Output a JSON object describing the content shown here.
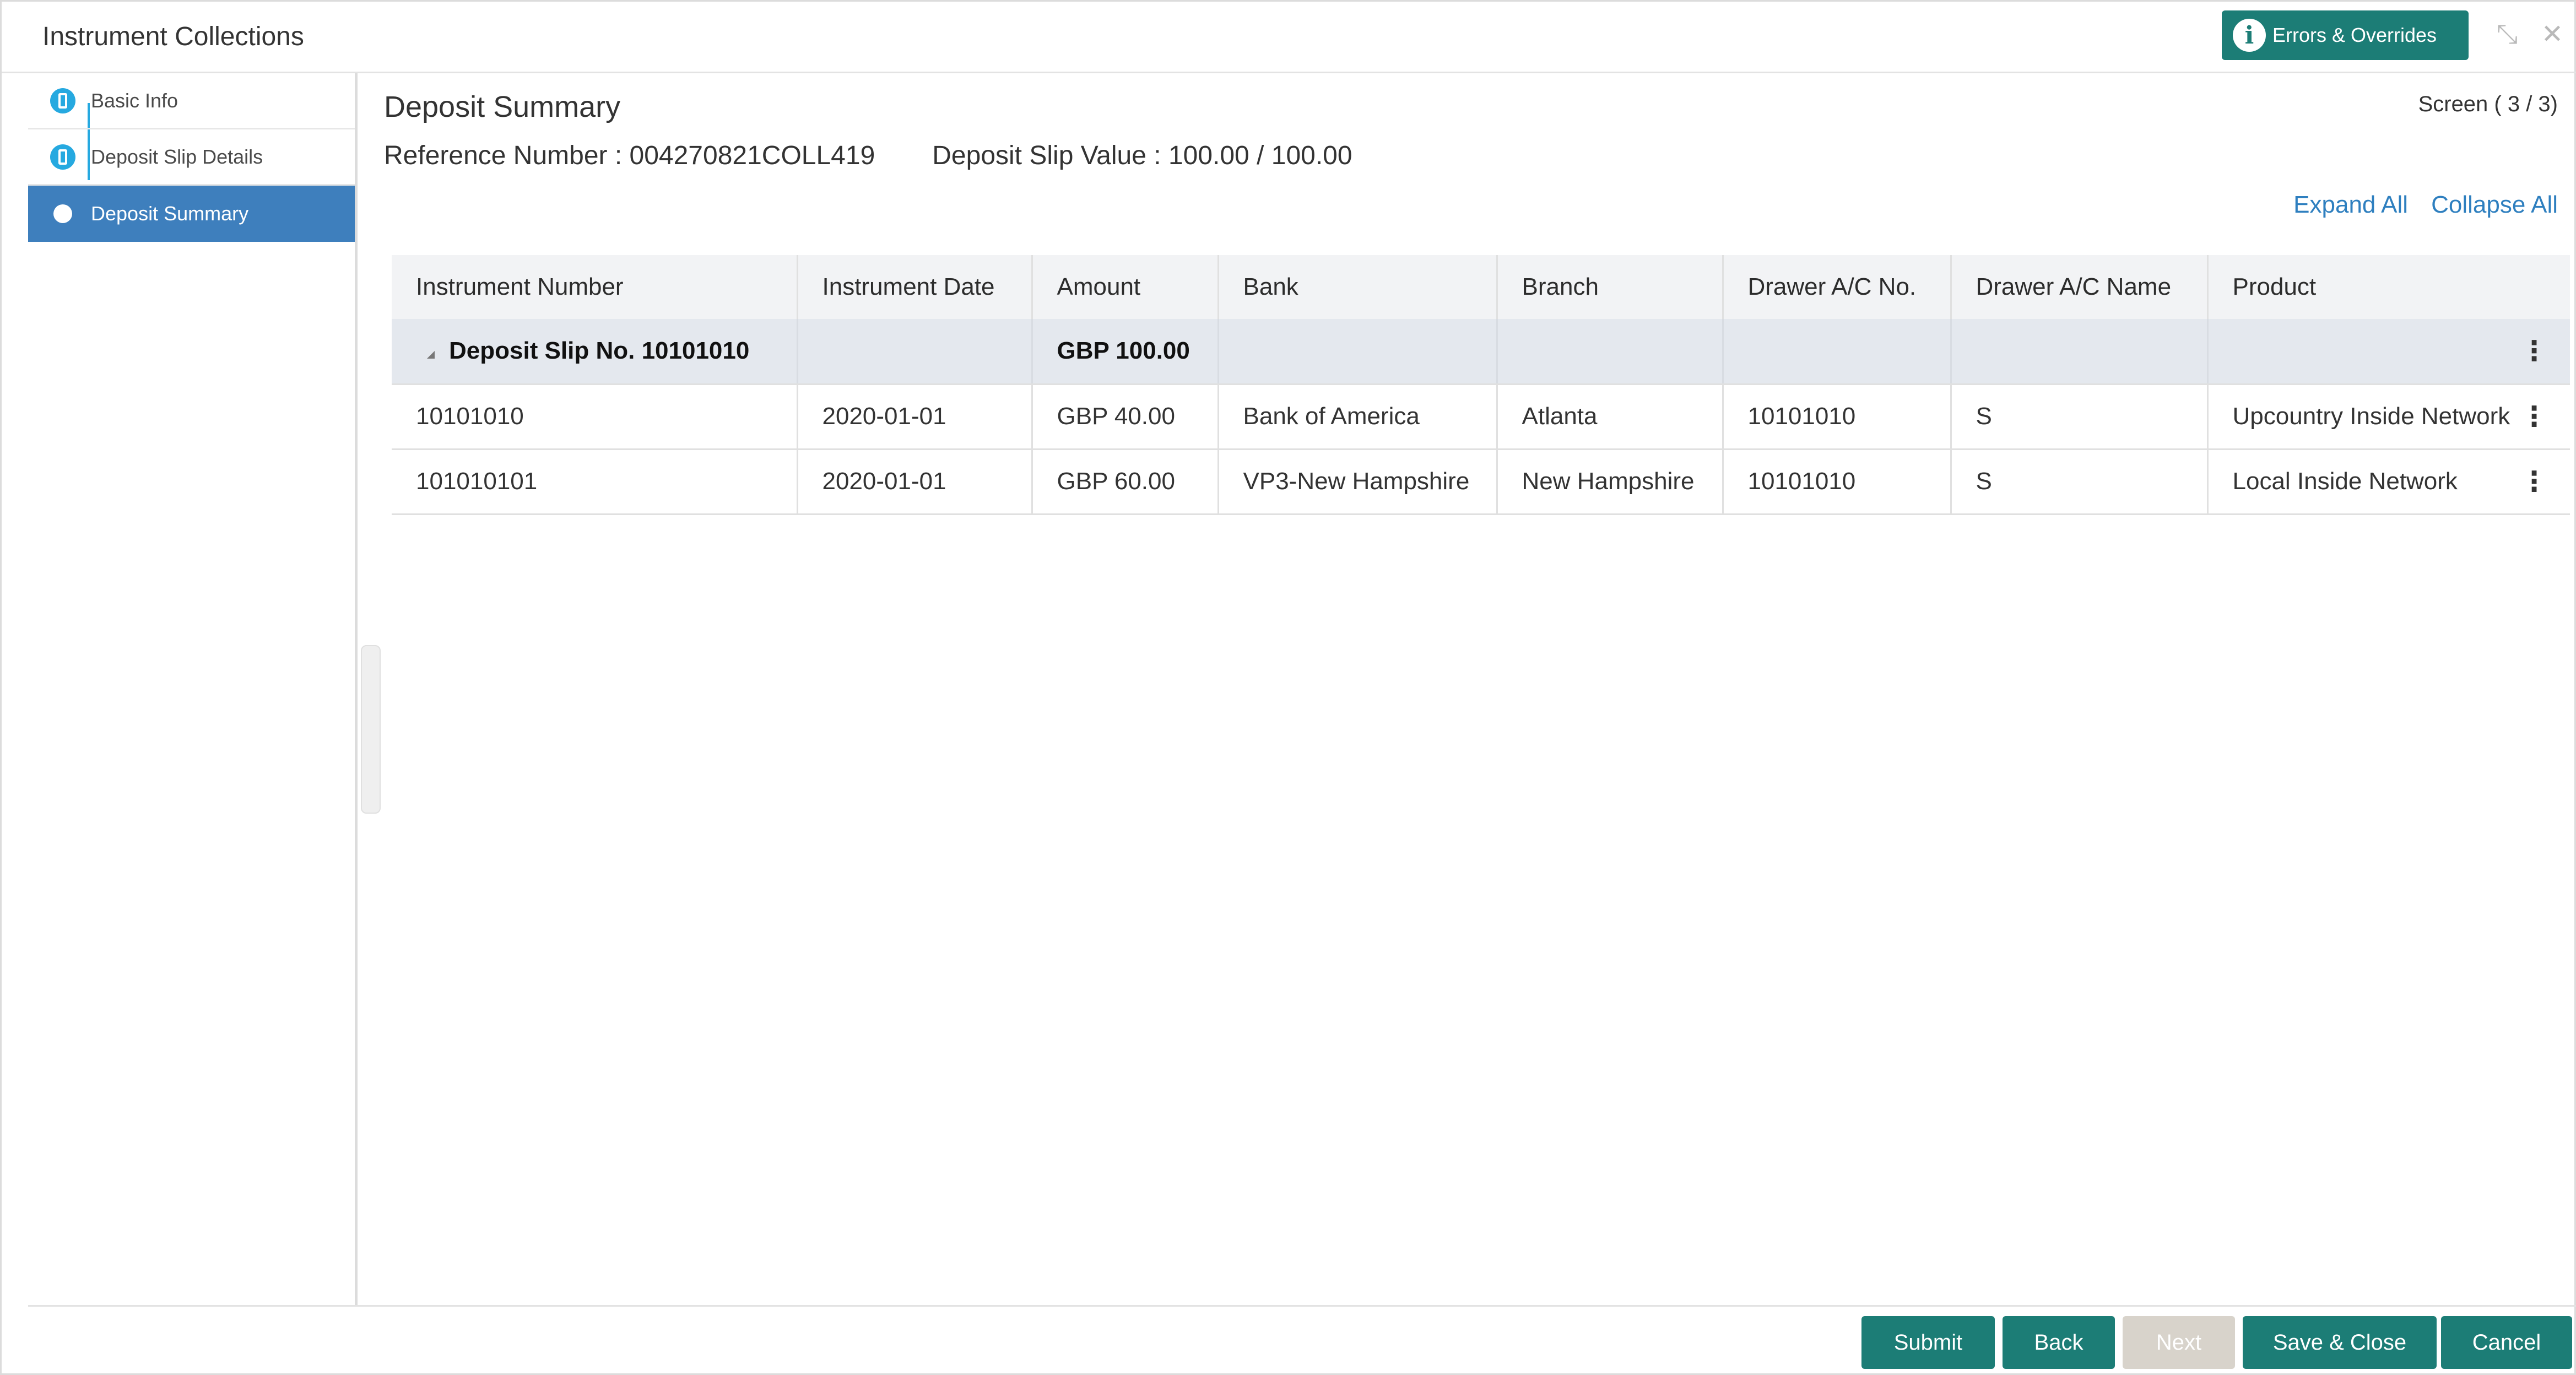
{
  "header": {
    "title": "Instrument Collections",
    "errors_label": "Errors & Overrides",
    "info_icon": "i",
    "minimize_icon": "⤡",
    "close_icon": "✕"
  },
  "sidebar": {
    "steps": [
      {
        "label": "Basic Info"
      },
      {
        "label": "Deposit Slip Details"
      },
      {
        "label": "Deposit Summary"
      }
    ]
  },
  "main": {
    "title": "Deposit Summary",
    "screen": "Screen ( 3 / 3)",
    "reference": "Reference Number : 004270821COLL419",
    "slip_value": "Deposit Slip Value : 100.00 / 100.00",
    "expand_all": "Expand All",
    "collapse_all": "Collapse All"
  },
  "table": {
    "columns": [
      "Instrument Number",
      "Instrument Date",
      "Amount",
      "Bank",
      "Branch",
      "Drawer A/C No.",
      "Drawer A/C Name",
      "Product"
    ],
    "group": {
      "label": "Deposit Slip No. 10101010",
      "amount": "GBP 100.00"
    },
    "rows": [
      {
        "number": "10101010",
        "date": "2020-01-01",
        "amount": "GBP 40.00",
        "bank": "Bank of America",
        "branch": "Atlanta",
        "drawer_no": "10101010",
        "drawer_name": "S",
        "product": "Upcountry Inside Network"
      },
      {
        "number": "101010101",
        "date": "2020-01-01",
        "amount": "GBP 60.00",
        "bank": "VP3-New Hampshire",
        "branch": "New Hampshire",
        "drawer_no": "10101010",
        "drawer_name": "S",
        "product": "Local Inside Network"
      }
    ],
    "kebab_icon": "⋮"
  },
  "footer": {
    "submit": "Submit",
    "back": "Back",
    "next": "Next",
    "save_close": "Save & Close",
    "cancel": "Cancel"
  },
  "colors": {
    "accent": "#1c7d76",
    "active_step": "#3e7fbd",
    "step_dot": "#26a9e0",
    "link": "#2e7fbf"
  }
}
